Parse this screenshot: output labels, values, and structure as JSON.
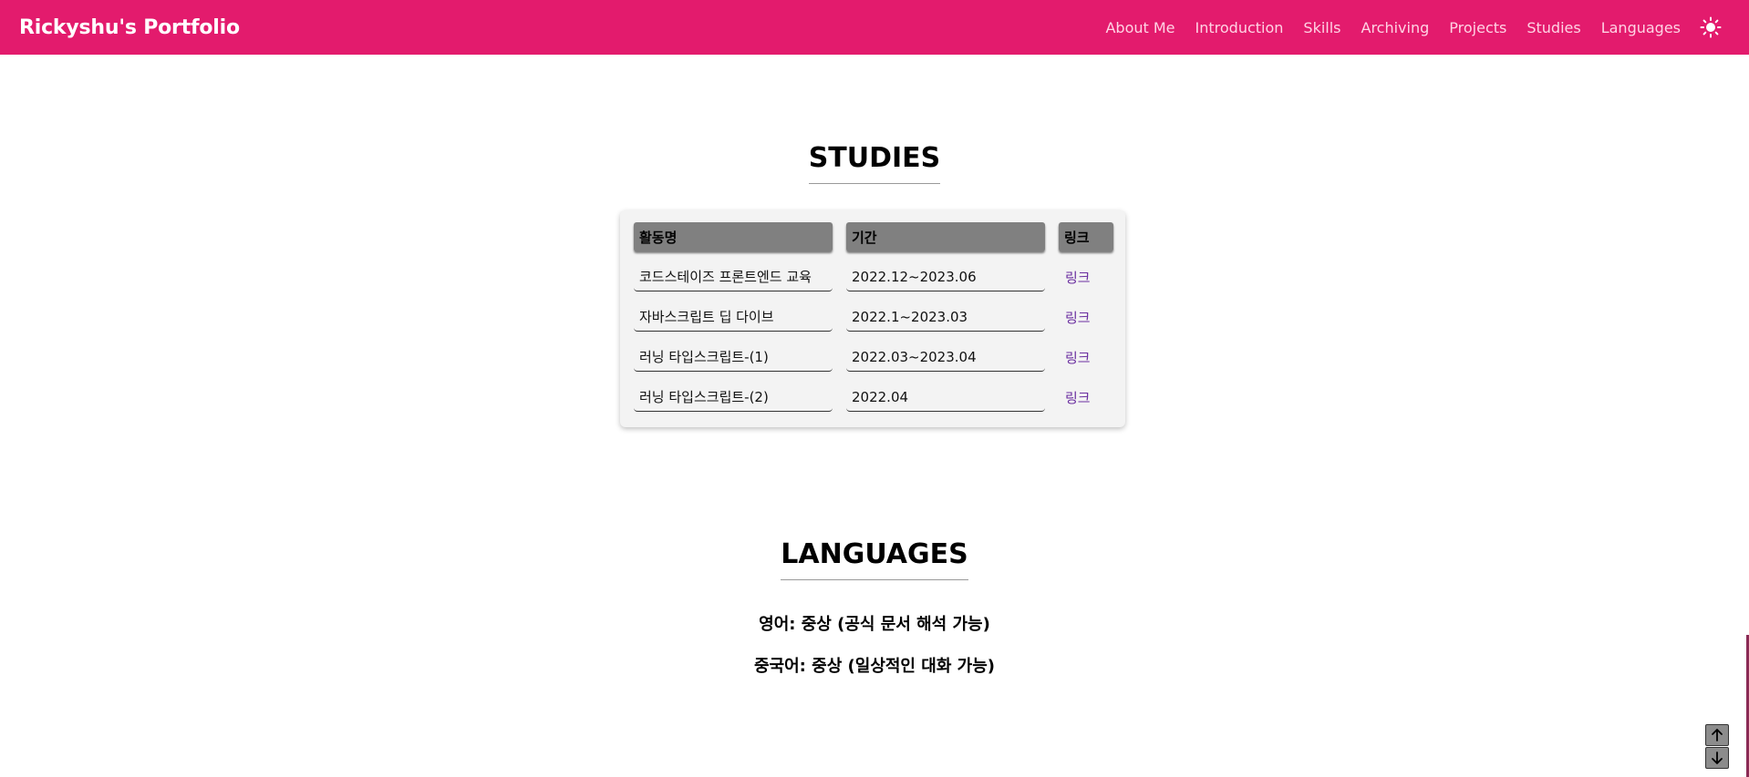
{
  "header": {
    "brand": "Rickyshu's Portfolio",
    "nav": [
      "About Me",
      "Introduction",
      "Skills",
      "Archiving",
      "Projects",
      "Studies",
      "Languages"
    ],
    "theme_icon": "sun-icon"
  },
  "studies": {
    "title": "STUDIES",
    "columns": [
      "활동명",
      "기간",
      "링크"
    ],
    "rows": [
      {
        "name": "코드스테이즈 프론트엔드 교육",
        "period": "2022.12~2023.06",
        "link": "링크"
      },
      {
        "name": "자바스크립트 딥 다이브",
        "period": "2022.1~2023.03",
        "link": "링크"
      },
      {
        "name": "러닝 타입스크립트-(1)",
        "period": "2022.03~2023.04",
        "link": "링크"
      },
      {
        "name": "러닝 타입스크립트-(2)",
        "period": "2022.04",
        "link": "링크"
      }
    ]
  },
  "languages": {
    "title": "LANGUAGES",
    "items": [
      "영어: 중상 (공식 문서 해석 가능)",
      "중국어: 중상 (일상적인 대화 가능)"
    ]
  },
  "colors": {
    "accent": "#e31b6d",
    "link": "#6b2fa0",
    "header_cell": "#808080"
  },
  "scroll_buttons": {
    "up_icon": "arrow-up-icon",
    "down_icon": "arrow-down-icon"
  }
}
